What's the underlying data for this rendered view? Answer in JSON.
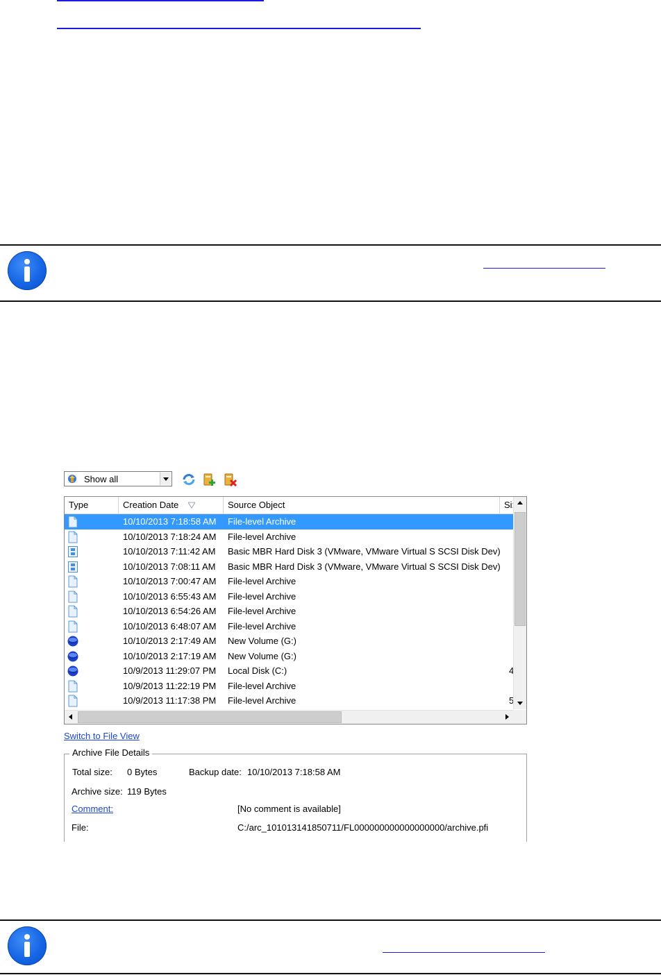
{
  "toolbar": {
    "filter_value": "Show all",
    "buttons": [
      {
        "name": "refresh-button",
        "icon": "refresh-icon"
      },
      {
        "name": "add-archive-button",
        "icon": "add-archive-icon"
      },
      {
        "name": "delete-archive-button",
        "icon": "delete-archive-icon"
      }
    ]
  },
  "grid": {
    "columns": {
      "type": "Type",
      "creation_date": "Creation Date",
      "source_object": "Source Object",
      "size": "Si:"
    },
    "rows": [
      {
        "icon": "file-archive-icon",
        "date": "10/10/2013 7:18:58 AM",
        "source": "File-level Archive",
        "size": "",
        "selected": true
      },
      {
        "icon": "file-archive-icon",
        "date": "10/10/2013 7:18:24 AM",
        "source": "File-level Archive",
        "size": ""
      },
      {
        "icon": "disk-archive-icon",
        "date": "10/10/2013 7:11:42 AM",
        "source": "Basic MBR Hard Disk 3 (VMware, VMware Virtual S SCSI Disk Dev)",
        "size": ""
      },
      {
        "icon": "disk-archive-icon",
        "date": "10/10/2013 7:08:11 AM",
        "source": "Basic MBR Hard Disk 3 (VMware, VMware Virtual S SCSI Disk Dev)",
        "size": ""
      },
      {
        "icon": "file-archive-icon",
        "date": "10/10/2013 7:00:47 AM",
        "source": "File-level Archive",
        "size": ""
      },
      {
        "icon": "file-archive-icon",
        "date": "10/10/2013 6:55:43 AM",
        "source": "File-level Archive",
        "size": ""
      },
      {
        "icon": "file-archive-icon",
        "date": "10/10/2013 6:54:26 AM",
        "source": "File-level Archive",
        "size": ""
      },
      {
        "icon": "file-archive-icon",
        "date": "10/10/2013 6:48:07 AM",
        "source": "File-level Archive",
        "size": ""
      },
      {
        "icon": "volume-archive-icon",
        "date": "10/10/2013 2:17:49 AM",
        "source": "New Volume (G:)",
        "size": ""
      },
      {
        "icon": "volume-archive-icon",
        "date": "10/10/2013 2:17:19 AM",
        "source": "New Volume (G:)",
        "size": ""
      },
      {
        "icon": "volume-archive-icon",
        "date": "10/9/2013 11:29:07 PM",
        "source": "Local Disk (C:)",
        "size": "4"
      },
      {
        "icon": "file-archive-icon",
        "date": "10/9/2013 11:22:19 PM",
        "source": "File-level Archive",
        "size": ""
      },
      {
        "icon": "file-archive-icon",
        "date": "10/9/2013 11:17:38 PM",
        "source": "File-level Archive",
        "size": "5"
      }
    ]
  },
  "switch_view_link": "Switch to File View",
  "details": {
    "title": "Archive File Details",
    "total_size_label": "Total size:",
    "total_size_value": "0 Bytes",
    "backup_date_label": "Backup date:",
    "backup_date_value": "10/10/2013 7:18:58 AM",
    "archive_size_label": "Archive size:",
    "archive_size_value": "119 Bytes",
    "comment_label": "Comment:",
    "comment_value": "[No comment is available]",
    "file_label": "File:",
    "file_value": "C:/arc_101013141850711/FL000000000000000000/archive.pfi"
  }
}
